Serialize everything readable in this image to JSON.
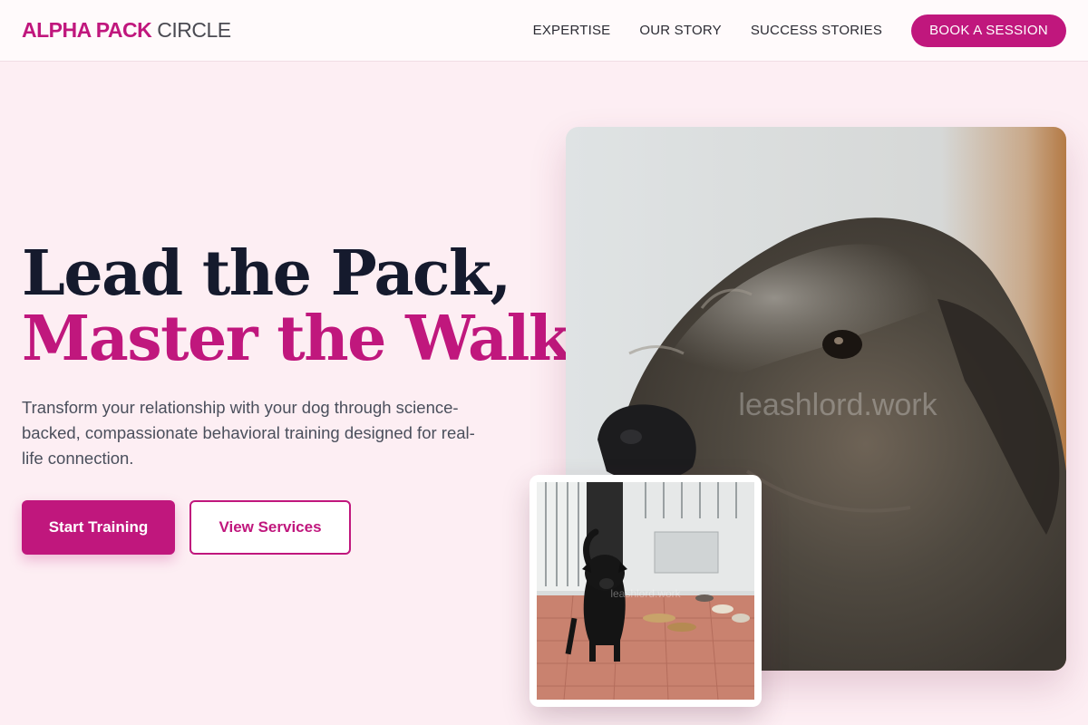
{
  "brand": {
    "name_bold": "ALPHA PACK",
    "name_light": "CIRCLE"
  },
  "nav": {
    "links": [
      "EXPERTISE",
      "OUR STORY",
      "SUCCESS STORIES"
    ],
    "cta": "BOOK A SESSION"
  },
  "hero": {
    "title_line1": "Lead the Pack,",
    "title_line2": "Master the Walk.",
    "subtitle": "Transform your relationship with your dog through science-backed, compassionate behavioral training designed for real-life connection.",
    "primary_button": "Start Training",
    "secondary_button": "View Services"
  },
  "images": {
    "main_watermark": "leashlord.work",
    "small_watermark": "leashlord.work"
  },
  "colors": {
    "accent": "#c0177d",
    "heading": "#151a2d",
    "background": "#fdeef3"
  }
}
